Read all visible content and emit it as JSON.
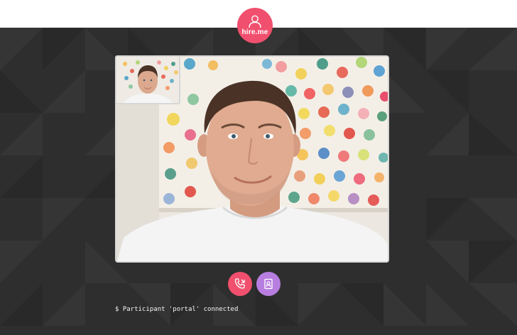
{
  "app": {
    "logo_text": "hire.me",
    "brand_color": "#f0506e",
    "accent_color": "#b77ee0",
    "logo_icon": "person-silhouette-icon"
  },
  "video": {
    "remote_feed": "remote-participant-video",
    "local_feed": "self-preview-video"
  },
  "controls": {
    "hangup_icon": "phone-hangup-icon",
    "contact_icon": "contact-card-icon"
  },
  "console": {
    "message": "$ Participant 'portal' connected"
  }
}
